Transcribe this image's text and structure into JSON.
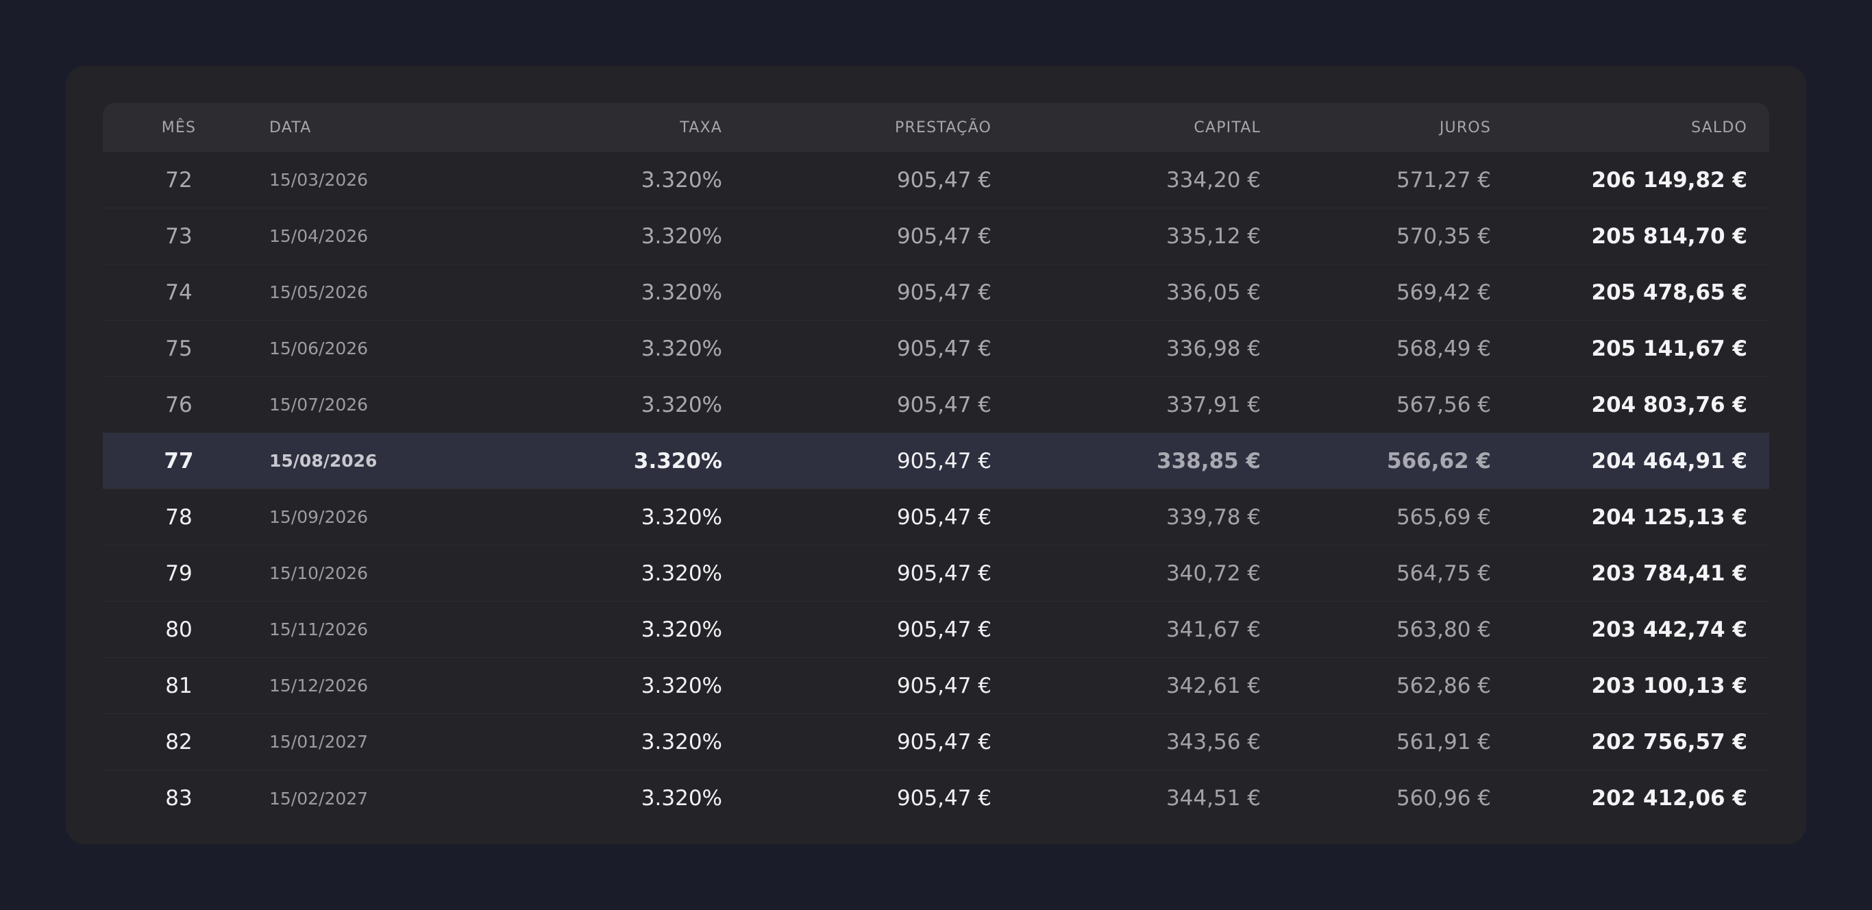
{
  "table": {
    "headers": {
      "mes": "MÊS",
      "data": "DATA",
      "taxa": "TAXA",
      "prestacao": "PRESTAÇÃO",
      "capital": "CAPITAL",
      "juros": "JUROS",
      "saldo": "SALDO"
    },
    "highlight_color": "#2e3040",
    "rows": [
      {
        "mes": "72",
        "data": "15/03/2026",
        "taxa": "3.320%",
        "prestacao": "905,47 €",
        "capital": "334,20 €",
        "juros": "571,27 €",
        "saldo": "206 149,82 €"
      },
      {
        "mes": "73",
        "data": "15/04/2026",
        "taxa": "3.320%",
        "prestacao": "905,47 €",
        "capital": "335,12 €",
        "juros": "570,35 €",
        "saldo": "205 814,70 €"
      },
      {
        "mes": "74",
        "data": "15/05/2026",
        "taxa": "3.320%",
        "prestacao": "905,47 €",
        "capital": "336,05 €",
        "juros": "569,42 €",
        "saldo": "205 478,65 €"
      },
      {
        "mes": "75",
        "data": "15/06/2026",
        "taxa": "3.320%",
        "prestacao": "905,47 €",
        "capital": "336,98 €",
        "juros": "568,49 €",
        "saldo": "205 141,67 €"
      },
      {
        "mes": "76",
        "data": "15/07/2026",
        "taxa": "3.320%",
        "prestacao": "905,47 €",
        "capital": "337,91 €",
        "juros": "567,56 €",
        "saldo": "204 803,76 €"
      },
      {
        "mes": "77",
        "data": "15/08/2026",
        "taxa": "3.320%",
        "prestacao": "905,47 €",
        "capital": "338,85 €",
        "juros": "566,62 €",
        "saldo": "204 464,91 €"
      },
      {
        "mes": "78",
        "data": "15/09/2026",
        "taxa": "3.320%",
        "prestacao": "905,47 €",
        "capital": "339,78 €",
        "juros": "565,69 €",
        "saldo": "204 125,13 €"
      },
      {
        "mes": "79",
        "data": "15/10/2026",
        "taxa": "3.320%",
        "prestacao": "905,47 €",
        "capital": "340,72 €",
        "juros": "564,75 €",
        "saldo": "203 784,41 €"
      },
      {
        "mes": "80",
        "data": "15/11/2026",
        "taxa": "3.320%",
        "prestacao": "905,47 €",
        "capital": "341,67 €",
        "juros": "563,80 €",
        "saldo": "203 442,74 €"
      },
      {
        "mes": "81",
        "data": "15/12/2026",
        "taxa": "3.320%",
        "prestacao": "905,47 €",
        "capital": "342,61 €",
        "juros": "562,86 €",
        "saldo": "203 100,13 €"
      },
      {
        "mes": "82",
        "data": "15/01/2027",
        "taxa": "3.320%",
        "prestacao": "905,47 €",
        "capital": "343,56 €",
        "juros": "561,91 €",
        "saldo": "202 756,57 €"
      },
      {
        "mes": "83",
        "data": "15/02/2027",
        "taxa": "3.320%",
        "prestacao": "905,47 €",
        "capital": "344,51 €",
        "juros": "560,96 €",
        "saldo": "202 412,06 €"
      }
    ]
  }
}
